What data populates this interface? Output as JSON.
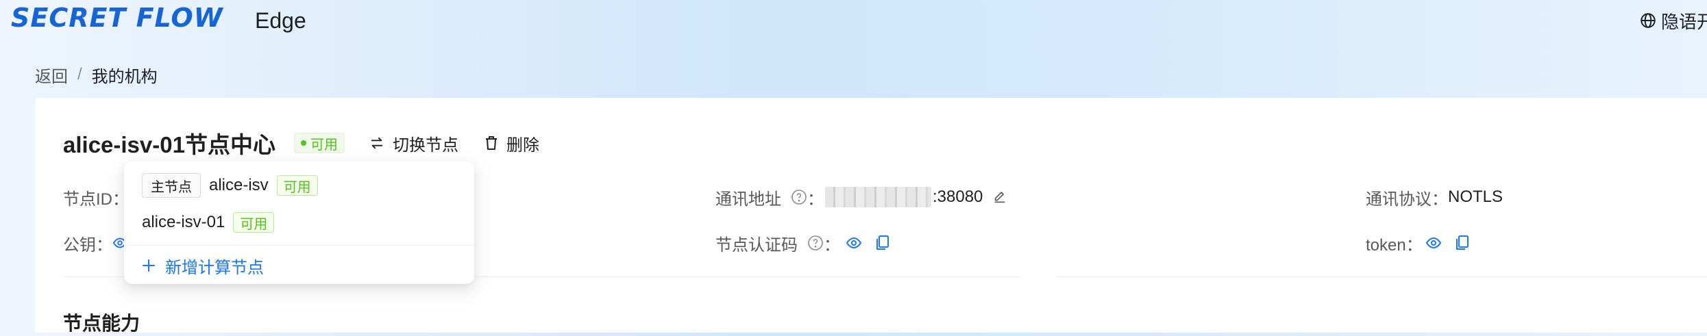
{
  "header": {
    "logo_text": "SECRET FLOW",
    "app_name": "Edge",
    "language_label": "隐语开",
    "brand_color": "#1565d8"
  },
  "breadcrumb": {
    "back": "返回",
    "separator": "/",
    "current": "我的机构"
  },
  "node": {
    "title": "alice-isv-01节点中心",
    "status": "可用",
    "switch_label": "切换节点",
    "delete_label": "删除",
    "status_color": "#52c41a"
  },
  "fields": {
    "node_id_label": "节点ID：",
    "public_key_label": "公钥：",
    "address_label": "通讯地址",
    "address_colon": "：",
    "address_port": ":38080",
    "cert_label": "节点认证码",
    "cert_colon": "：",
    "protocol_label": "通讯协议：",
    "protocol_value": "NOTLS",
    "token_label": "token："
  },
  "section": {
    "capability_title": "节点能力"
  },
  "node_dropdown": {
    "items": [
      {
        "badge": "主节点",
        "name": "alice-isv",
        "status": "可用"
      },
      {
        "badge": "",
        "name": "alice-isv-01",
        "status": "可用"
      }
    ],
    "add_label": "新增计算节点",
    "accent_color": "#1677ff"
  },
  "icons": {
    "language": "globe-icon",
    "switch": "swap-icon",
    "delete": "trash-icon",
    "help": "question-circle-icon",
    "edit": "edit-icon",
    "view": "eye-icon",
    "copy": "copy-icon",
    "add": "plus-icon"
  }
}
